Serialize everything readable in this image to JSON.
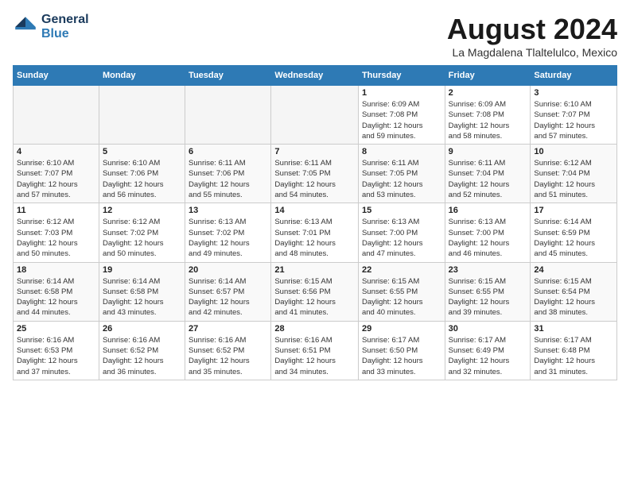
{
  "header": {
    "logo_line1": "General",
    "logo_line2": "Blue",
    "month_year": "August 2024",
    "location": "La Magdalena Tlaltelulco, Mexico"
  },
  "weekdays": [
    "Sunday",
    "Monday",
    "Tuesday",
    "Wednesday",
    "Thursday",
    "Friday",
    "Saturday"
  ],
  "weeks": [
    [
      {
        "day": "",
        "info": ""
      },
      {
        "day": "",
        "info": ""
      },
      {
        "day": "",
        "info": ""
      },
      {
        "day": "",
        "info": ""
      },
      {
        "day": "1",
        "info": "Sunrise: 6:09 AM\nSunset: 7:08 PM\nDaylight: 12 hours\nand 59 minutes."
      },
      {
        "day": "2",
        "info": "Sunrise: 6:09 AM\nSunset: 7:08 PM\nDaylight: 12 hours\nand 58 minutes."
      },
      {
        "day": "3",
        "info": "Sunrise: 6:10 AM\nSunset: 7:07 PM\nDaylight: 12 hours\nand 57 minutes."
      }
    ],
    [
      {
        "day": "4",
        "info": "Sunrise: 6:10 AM\nSunset: 7:07 PM\nDaylight: 12 hours\nand 57 minutes."
      },
      {
        "day": "5",
        "info": "Sunrise: 6:10 AM\nSunset: 7:06 PM\nDaylight: 12 hours\nand 56 minutes."
      },
      {
        "day": "6",
        "info": "Sunrise: 6:11 AM\nSunset: 7:06 PM\nDaylight: 12 hours\nand 55 minutes."
      },
      {
        "day": "7",
        "info": "Sunrise: 6:11 AM\nSunset: 7:05 PM\nDaylight: 12 hours\nand 54 minutes."
      },
      {
        "day": "8",
        "info": "Sunrise: 6:11 AM\nSunset: 7:05 PM\nDaylight: 12 hours\nand 53 minutes."
      },
      {
        "day": "9",
        "info": "Sunrise: 6:11 AM\nSunset: 7:04 PM\nDaylight: 12 hours\nand 52 minutes."
      },
      {
        "day": "10",
        "info": "Sunrise: 6:12 AM\nSunset: 7:04 PM\nDaylight: 12 hours\nand 51 minutes."
      }
    ],
    [
      {
        "day": "11",
        "info": "Sunrise: 6:12 AM\nSunset: 7:03 PM\nDaylight: 12 hours\nand 50 minutes."
      },
      {
        "day": "12",
        "info": "Sunrise: 6:12 AM\nSunset: 7:02 PM\nDaylight: 12 hours\nand 50 minutes."
      },
      {
        "day": "13",
        "info": "Sunrise: 6:13 AM\nSunset: 7:02 PM\nDaylight: 12 hours\nand 49 minutes."
      },
      {
        "day": "14",
        "info": "Sunrise: 6:13 AM\nSunset: 7:01 PM\nDaylight: 12 hours\nand 48 minutes."
      },
      {
        "day": "15",
        "info": "Sunrise: 6:13 AM\nSunset: 7:00 PM\nDaylight: 12 hours\nand 47 minutes."
      },
      {
        "day": "16",
        "info": "Sunrise: 6:13 AM\nSunset: 7:00 PM\nDaylight: 12 hours\nand 46 minutes."
      },
      {
        "day": "17",
        "info": "Sunrise: 6:14 AM\nSunset: 6:59 PM\nDaylight: 12 hours\nand 45 minutes."
      }
    ],
    [
      {
        "day": "18",
        "info": "Sunrise: 6:14 AM\nSunset: 6:58 PM\nDaylight: 12 hours\nand 44 minutes."
      },
      {
        "day": "19",
        "info": "Sunrise: 6:14 AM\nSunset: 6:58 PM\nDaylight: 12 hours\nand 43 minutes."
      },
      {
        "day": "20",
        "info": "Sunrise: 6:14 AM\nSunset: 6:57 PM\nDaylight: 12 hours\nand 42 minutes."
      },
      {
        "day": "21",
        "info": "Sunrise: 6:15 AM\nSunset: 6:56 PM\nDaylight: 12 hours\nand 41 minutes."
      },
      {
        "day": "22",
        "info": "Sunrise: 6:15 AM\nSunset: 6:55 PM\nDaylight: 12 hours\nand 40 minutes."
      },
      {
        "day": "23",
        "info": "Sunrise: 6:15 AM\nSunset: 6:55 PM\nDaylight: 12 hours\nand 39 minutes."
      },
      {
        "day": "24",
        "info": "Sunrise: 6:15 AM\nSunset: 6:54 PM\nDaylight: 12 hours\nand 38 minutes."
      }
    ],
    [
      {
        "day": "25",
        "info": "Sunrise: 6:16 AM\nSunset: 6:53 PM\nDaylight: 12 hours\nand 37 minutes."
      },
      {
        "day": "26",
        "info": "Sunrise: 6:16 AM\nSunset: 6:52 PM\nDaylight: 12 hours\nand 36 minutes."
      },
      {
        "day": "27",
        "info": "Sunrise: 6:16 AM\nSunset: 6:52 PM\nDaylight: 12 hours\nand 35 minutes."
      },
      {
        "day": "28",
        "info": "Sunrise: 6:16 AM\nSunset: 6:51 PM\nDaylight: 12 hours\nand 34 minutes."
      },
      {
        "day": "29",
        "info": "Sunrise: 6:17 AM\nSunset: 6:50 PM\nDaylight: 12 hours\nand 33 minutes."
      },
      {
        "day": "30",
        "info": "Sunrise: 6:17 AM\nSunset: 6:49 PM\nDaylight: 12 hours\nand 32 minutes."
      },
      {
        "day": "31",
        "info": "Sunrise: 6:17 AM\nSunset: 6:48 PM\nDaylight: 12 hours\nand 31 minutes."
      }
    ]
  ]
}
